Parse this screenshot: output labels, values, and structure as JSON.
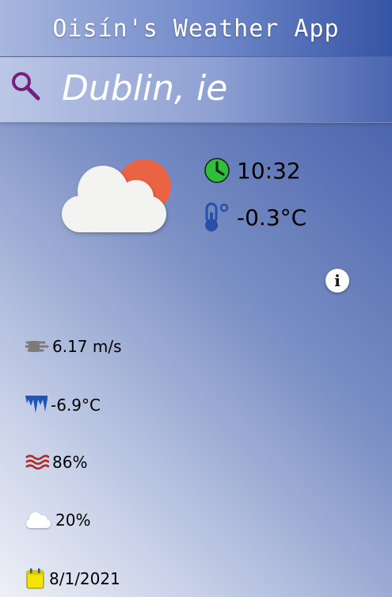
{
  "header": {
    "title": "Oisín's Weather App"
  },
  "search": {
    "city": "Dublin, ie"
  },
  "current": {
    "time": "10:32",
    "temperature": "-0.3°C"
  },
  "stats": {
    "wind": "6.17 m/s",
    "dew_point": "-6.9°C",
    "humidity": "86%",
    "clouds": "20%",
    "date": "8/1/2021"
  },
  "colors": {
    "clock": "#2fbf3a",
    "thermometer": "#2a4fa8",
    "sun": "#ea6444",
    "search_icon": "#7a1e7e",
    "humidity": "#b12a2a",
    "calendar": "#f2e600"
  },
  "icons": {
    "search": "search-icon",
    "weather": "partly-cloudy-icon",
    "clock": "clock-icon",
    "thermometer": "thermometer-icon",
    "info": "info-icon",
    "wind": "wind-icon",
    "dew_point": "icicle-icon",
    "humidity": "humidity-waves-icon",
    "clouds": "cloud-icon",
    "date": "calendar-icon"
  }
}
